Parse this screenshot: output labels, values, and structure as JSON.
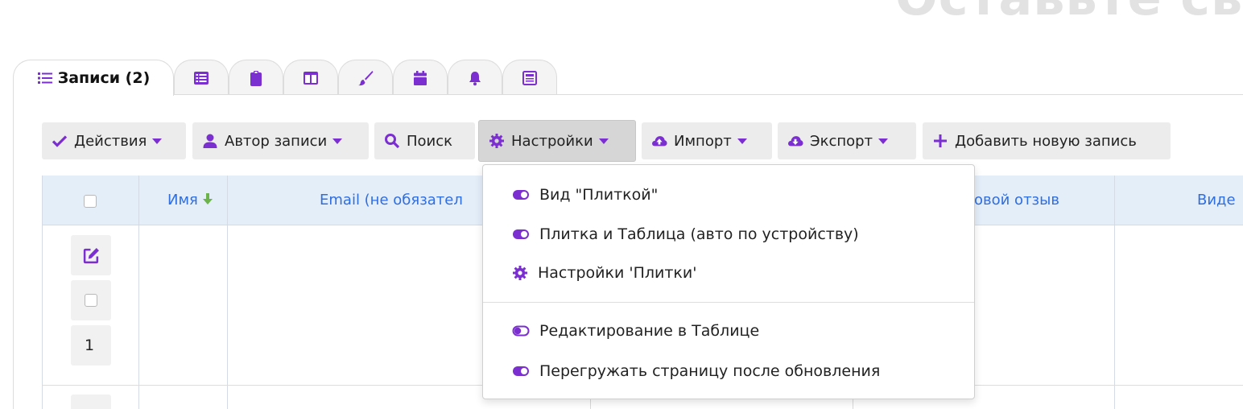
{
  "page": {
    "heading": "Оставьте сво"
  },
  "tabs": [
    {
      "label": "Записи (2)",
      "icon": "list-icon"
    },
    {
      "label": "",
      "icon": "table-list-icon"
    },
    {
      "label": "",
      "icon": "clipboard-icon"
    },
    {
      "label": "",
      "icon": "columns-icon"
    },
    {
      "label": "",
      "icon": "paint-brush-icon"
    },
    {
      "label": "",
      "icon": "calendar-icon"
    },
    {
      "label": "",
      "icon": "bell-icon"
    },
    {
      "label": "",
      "icon": "newspaper-icon"
    }
  ],
  "toolbar": {
    "actions": "Действия",
    "author": "Автор записи",
    "search": "Поиск",
    "settings": "Настройки",
    "import": "Импорт",
    "export": "Экспорт",
    "add": "Добавить новую запись"
  },
  "table": {
    "headers": {
      "name": "Имя",
      "email": "Email (не обязател",
      "review": "овой отзыв",
      "video": "Виде"
    },
    "rows": [
      {
        "number": "1"
      }
    ]
  },
  "settings_menu": {
    "items": [
      {
        "label": "Вид \"Плиткой\"",
        "icon": "toggle-on-icon"
      },
      {
        "label": "Плитка и Таблица (авто по устройству)",
        "icon": "toggle-on-icon"
      },
      {
        "label": "Настройки 'Плитки'",
        "icon": "gear-icon"
      },
      {
        "label": "Редактирование в Таблице",
        "icon": "toggle-off-icon"
      },
      {
        "label": "Перегружать страницу после обновления",
        "icon": "toggle-on-icon"
      }
    ]
  },
  "colors": {
    "accent": "#7b2fd0",
    "header_bg": "#e4eef9",
    "header_text": "#2f6ee0",
    "sort_arrow": "#6bb34a"
  }
}
